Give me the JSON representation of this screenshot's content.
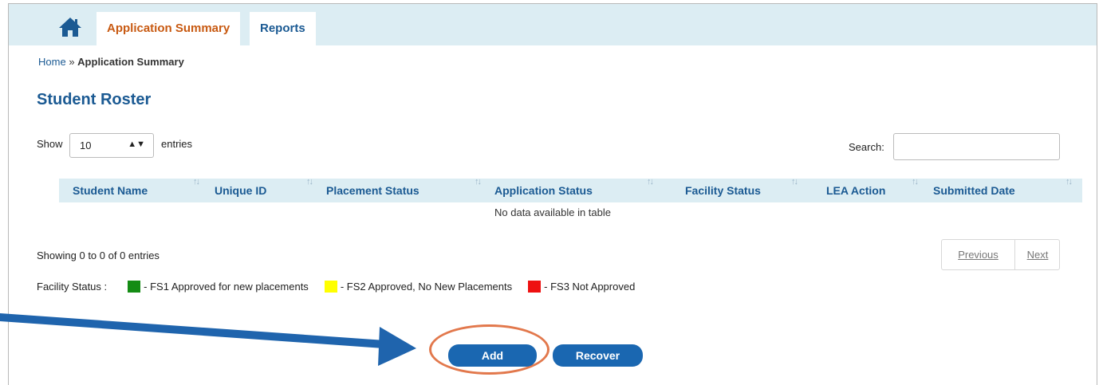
{
  "nav": {
    "home_icon": "home-icon",
    "tabs": [
      {
        "label": "Application Summary",
        "active": true
      },
      {
        "label": "Reports",
        "active": false
      }
    ]
  },
  "breadcrumb": {
    "home": "Home",
    "separator": "»",
    "current": "Application Summary"
  },
  "page": {
    "title": "Student Roster"
  },
  "table_controls": {
    "show_label": "Show",
    "entries_value": "10",
    "entries_label": "entries",
    "search_label": "Search:",
    "search_value": ""
  },
  "table": {
    "columns": [
      "Student Name",
      "Unique ID",
      "Placement Status",
      "Application Status",
      "Facility Status",
      "LEA Action",
      "Submitted Date"
    ],
    "empty_message": "No data available in table",
    "rows": []
  },
  "footer": {
    "showing": "Showing 0 to 0 of 0 entries",
    "prev_label": "Previous",
    "next_label": "Next"
  },
  "legend": {
    "label": "Facility Status :",
    "items": [
      {
        "color": "#148c14",
        "text": "- FS1  Approved for new placements"
      },
      {
        "color": "#ffff00",
        "text": "- FS2  Approved, No New Placements"
      },
      {
        "color": "#ee1111",
        "text": "- FS3  Not Approved"
      }
    ]
  },
  "actions": {
    "add_label": "Add",
    "recover_label": "Recover"
  },
  "colors": {
    "accent": "#1a67b1",
    "nav_bg": "#dcedf3",
    "active_tab": "#c85a12",
    "annotation": "#e2784c",
    "arrow": "#1f64ad"
  }
}
